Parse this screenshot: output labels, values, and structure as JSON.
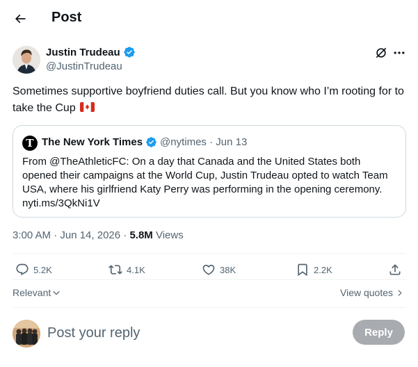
{
  "header": {
    "title": "Post"
  },
  "author": {
    "name": "Justin Trudeau",
    "handle": "@JustinTrudeau"
  },
  "tweet": {
    "text": "Sometimes supportive boyfriend duties call. But you know who I’m rooting for to take the Cup"
  },
  "quote": {
    "name": "The New York Times",
    "handle": "@nytimes",
    "separator": "·",
    "date": "Jun 13",
    "text": "From @TheAthleticFC: On a day that Canada and the United States both opened their campaigns at the World Cup, Justin Trudeau opted to watch Team USA, where his girlfriend Katy Perry was performing in the opening ceremony. nyti.ms/3QkNi1V"
  },
  "meta": {
    "time": "3:00 AM · Jun 14, 2026 · ",
    "views_count": "5.8M",
    "views_label": " Views"
  },
  "actions": {
    "replies": "5.2K",
    "reposts": "4.1K",
    "likes": "38K",
    "bookmarks": "2.2K"
  },
  "sort": {
    "label": "Relevant"
  },
  "quotes_link": {
    "label": "View quotes"
  },
  "reply": {
    "placeholder": "Post your reply",
    "button": "Reply"
  },
  "colors": {
    "verified": "#1d9bf0",
    "secondary_text": "#536471",
    "border": "#cfd9de"
  }
}
